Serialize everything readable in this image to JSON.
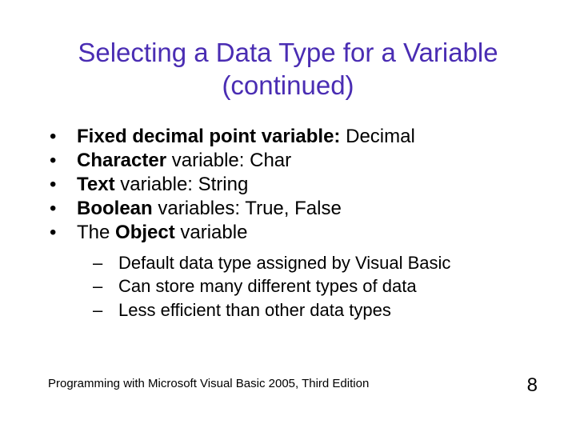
{
  "title_line1": "Selecting a Data Type for a Variable",
  "title_line2": "(continued)",
  "bullets": {
    "b1_bold": "Fixed decimal point variable:",
    "b1_rest": " Decimal",
    "b2_bold": "Character",
    "b2_rest": " variable: Char",
    "b3_bold": "Text",
    "b3_rest": " variable: String",
    "b4_bold": "Boolean",
    "b4_rest": " variables: True, False",
    "b5_pre": "The ",
    "b5_bold": "Object",
    "b5_post": " variable"
  },
  "sub": {
    "s1": "Default data type assigned by Visual Basic",
    "s2": "Can store many different types of data",
    "s3": "Less efficient than other data types"
  },
  "marker_main": "•",
  "marker_sub": "–",
  "footer_book": "Programming with Microsoft Visual Basic 2005, Third Edition",
  "page_number": "8"
}
